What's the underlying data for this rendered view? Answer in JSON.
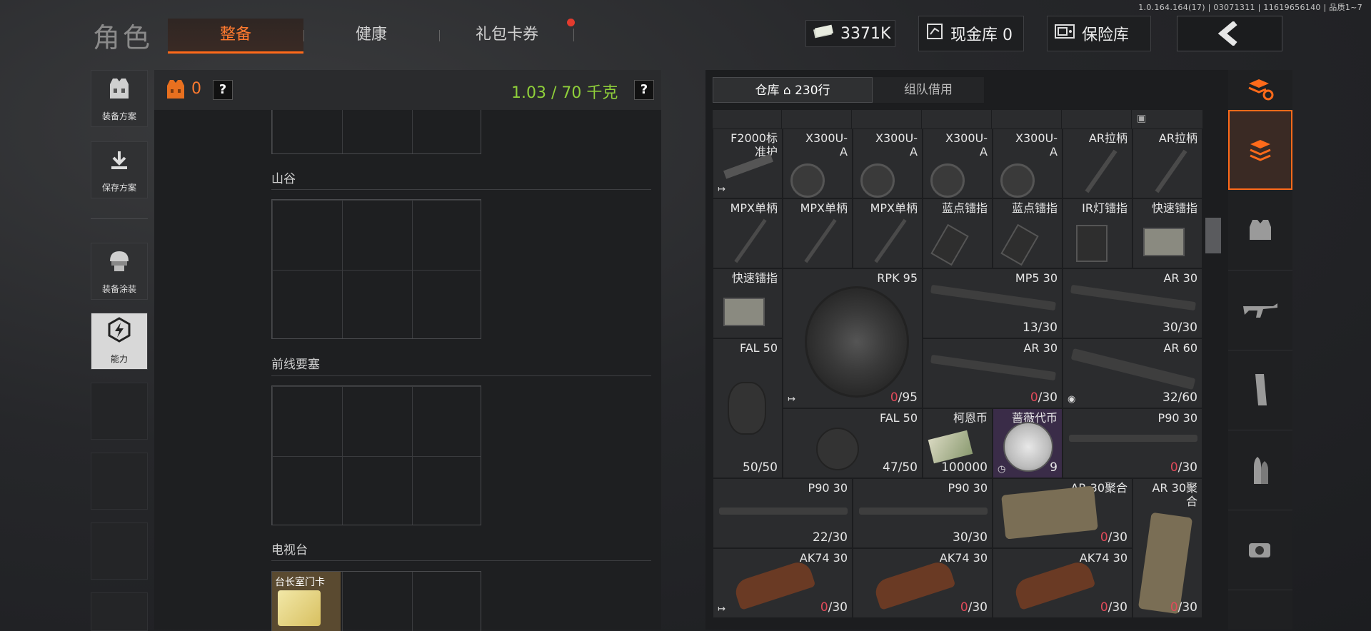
{
  "version": "1.0.164.164(17) | 03071311 | 11619656140 | 品质1~7",
  "title": "角色",
  "tabs": [
    {
      "label": "整备",
      "active": true
    },
    {
      "label": "健康",
      "active": false
    },
    {
      "label": "礼包卡券",
      "active": false
    }
  ],
  "currency": {
    "cash": "3371K",
    "cash_vault": "现金库 0",
    "safe": "保险库"
  },
  "left_buttons": [
    {
      "label": "装备方案",
      "icon": "armor-vest-icon"
    },
    {
      "label": "保存方案",
      "icon": "download-icon"
    },
    {
      "label": "装备涂装",
      "icon": "helmet-icon"
    },
    {
      "label": "能力",
      "icon": "hex-lightning-icon"
    }
  ],
  "loadout": {
    "armor_count": "0",
    "help": "?",
    "weight": "1.03 / 70 千克",
    "slots": [
      "山谷",
      "前线要塞",
      "电视台"
    ],
    "card_item": "台长室门卡"
  },
  "warehouse": {
    "tab_warehouse": "仓库",
    "rows": "230行",
    "tab_team": "组队借用"
  },
  "items": [
    {
      "id": "f2000",
      "name": "F2000标\n准护",
      "count": ""
    },
    {
      "id": "x300a",
      "name": "X300U-\nA",
      "count": ""
    },
    {
      "id": "x300b",
      "name": "X300U-\nA",
      "count": ""
    },
    {
      "id": "x300c",
      "name": "X300U-\nA",
      "count": ""
    },
    {
      "id": "x300d",
      "name": "X300U-\nA",
      "count": ""
    },
    {
      "id": "arch1",
      "name": "AR拉柄",
      "count": ""
    },
    {
      "id": "arch2",
      "name": "AR拉柄",
      "count": ""
    },
    {
      "id": "mpx1",
      "name": "MPX单柄",
      "count": ""
    },
    {
      "id": "mpx2",
      "name": "MPX单柄",
      "count": ""
    },
    {
      "id": "mpx3",
      "name": "MPX单柄",
      "count": ""
    },
    {
      "id": "red1",
      "name": "蓝点镭指",
      "count": ""
    },
    {
      "id": "red2",
      "name": "蓝点镭指",
      "count": ""
    },
    {
      "id": "ir",
      "name": "IR灯镭指",
      "count": ""
    },
    {
      "id": "fast1",
      "name": "快速镭指",
      "count": ""
    },
    {
      "id": "fast2",
      "name": "快速镭指",
      "count": ""
    },
    {
      "id": "rpk",
      "name": "RPK 95",
      "count_zero": "0",
      "count_rest": "/95"
    },
    {
      "id": "mp5",
      "name": "MP5 30",
      "count": "13/30"
    },
    {
      "id": "ar30a",
      "name": "AR 30",
      "count": "30/30"
    },
    {
      "id": "fal1",
      "name": "FAL 50",
      "count": "50/50"
    },
    {
      "id": "ar30b",
      "name": "AR 30",
      "count_zero": "0",
      "count_rest": "/30"
    },
    {
      "id": "ar60",
      "name": "AR 60",
      "count": "32/60"
    },
    {
      "id": "fal2",
      "name": "FAL 50",
      "count": "47/50"
    },
    {
      "id": "coin",
      "name": "柯恩币",
      "count": "100000"
    },
    {
      "id": "rose",
      "name": "蔷薇代币",
      "count": "9"
    },
    {
      "id": "p90a",
      "name": "P90 30",
      "count_zero": "0",
      "count_rest": "/30"
    },
    {
      "id": "p90b",
      "name": "P90 30",
      "count": "22/30"
    },
    {
      "id": "p90c",
      "name": "P90 30",
      "count": "30/30"
    },
    {
      "id": "ar30j1",
      "name": "AR 30聚合",
      "count_zero": "0",
      "count_rest": "/30"
    },
    {
      "id": "ar30j2",
      "name": "AR 30聚\n合",
      "count_zero": "0",
      "count_rest": "/30"
    },
    {
      "id": "ak1",
      "name": "AK74 30",
      "count_zero": "0",
      "count_rest": "/30"
    },
    {
      "id": "ak2",
      "name": "AK74 30",
      "count_zero": "0",
      "count_rest": "/30"
    },
    {
      "id": "ak3",
      "name": "AK74 30",
      "count_zero": "0",
      "count_rest": "/30"
    }
  ],
  "rail_icons": [
    "stack-refresh-icon",
    "warehouse-icon",
    "armor-vest-icon",
    "rifle-icon",
    "magazine-icon",
    "bullet-icon",
    "red-dot-sight-icon"
  ],
  "colors": {
    "accent": "#ff6a1a",
    "weight_green": "#8fcf3a",
    "zero_red": "#e24a5a"
  }
}
